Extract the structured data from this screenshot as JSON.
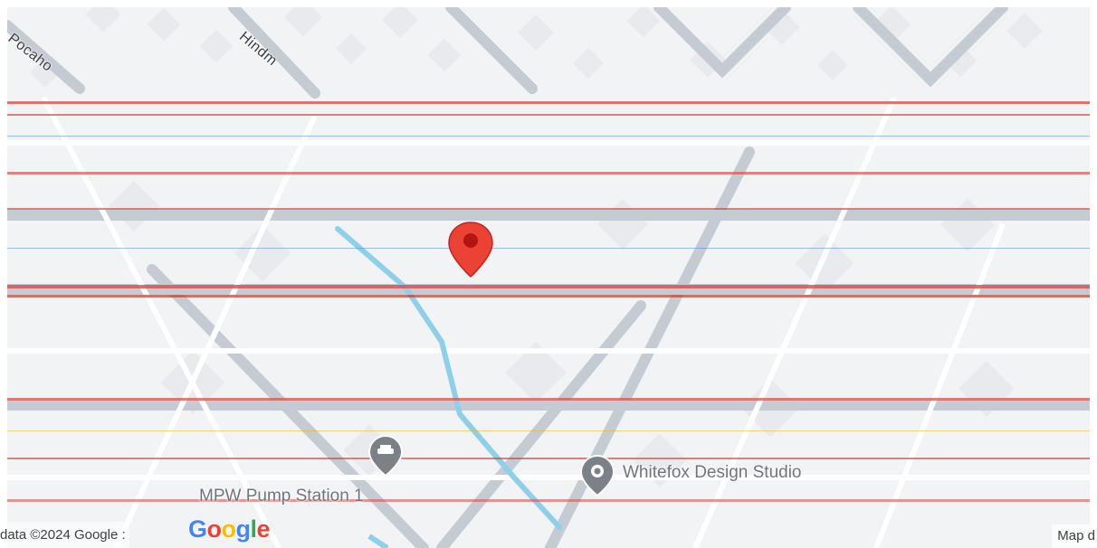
{
  "map": {
    "streets": {
      "north_west": "Pocaho",
      "north_center": "Hindm"
    },
    "pois": {
      "station": "MPW Pump Station 1",
      "studio": "Whitefox Design Studio"
    },
    "marker": {
      "color": "#ea4335"
    },
    "colors": {
      "road_main": "#c5cbd3",
      "road_minor": "#ffffff",
      "block": "#e8eaed",
      "water": "#8ed0ea",
      "poi_gray": "#7b8187"
    }
  },
  "attribution": {
    "left": "data ©2024 Google :",
    "logo": [
      "G",
      "o",
      "o",
      "g",
      "l",
      "e"
    ],
    "right": "Map d"
  }
}
